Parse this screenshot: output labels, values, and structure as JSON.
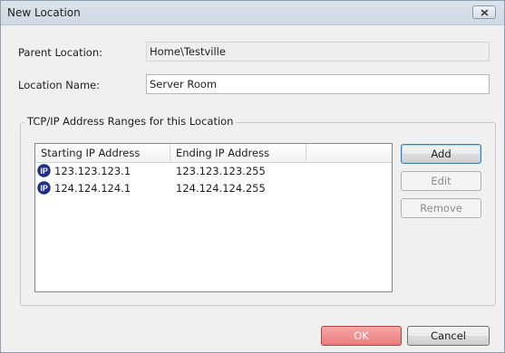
{
  "window": {
    "title": "New Location"
  },
  "form": {
    "parent_label": "Parent Location:",
    "parent_value": "Home\\Testville",
    "name_label": "Location Name:",
    "name_value": "Server Room"
  },
  "ranges": {
    "group_title": "TCP/IP Address Ranges for this Location",
    "columns": [
      "Starting IP Address",
      "Ending IP Address",
      ""
    ],
    "rows": [
      {
        "icon": "ip-icon",
        "start": "123.123.123.1",
        "end": "123.123.123.255"
      },
      {
        "icon": "ip-icon",
        "start": "124.124.124.1",
        "end": "124.124.124.255"
      }
    ]
  },
  "side_buttons": {
    "add": "Add",
    "edit": "Edit",
    "remove": "Remove"
  },
  "footer": {
    "ok": "OK",
    "cancel": "Cancel"
  },
  "colors": {
    "ip_badge": "#1f2f86",
    "ok_button": "#ea7d7d"
  }
}
